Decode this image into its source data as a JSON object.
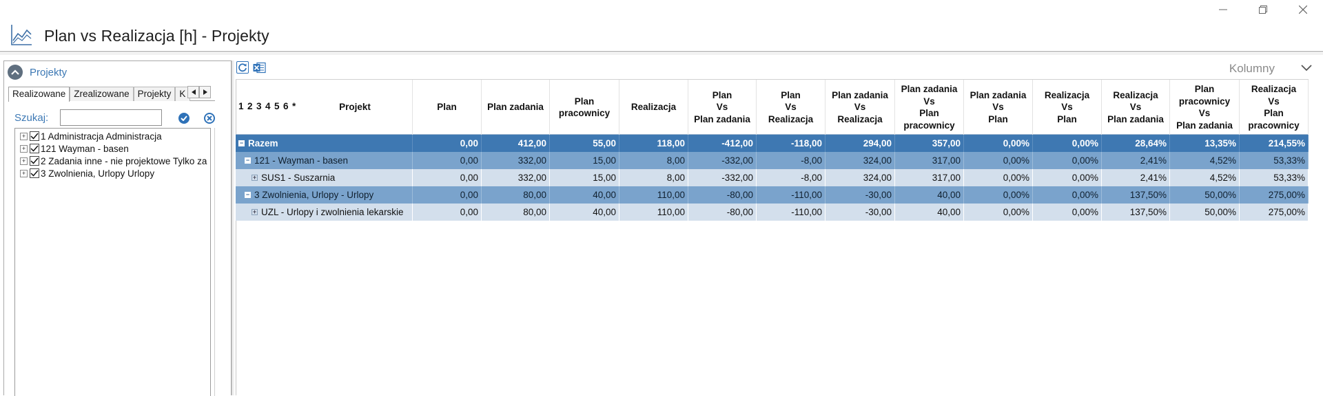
{
  "window": {
    "title": "Plan vs Realizacja [h] - Projekty",
    "controls": [
      "—",
      "❐",
      "✕"
    ]
  },
  "left_panel": {
    "title": "Projekty",
    "tabs": [
      "Realizowane",
      "Zrealizowane",
      "Projekty",
      "K"
    ],
    "search_label": "Szukaj:",
    "search_value": "",
    "tree": [
      "1 Administracja Administracja",
      "121 Wayman - basen",
      "2 Zadania inne - nie projektowe Tylko za",
      "3 Zwolnienia, Urlopy Urlopy"
    ]
  },
  "toolbar": {
    "columns_label": "Kolumny"
  },
  "grid": {
    "levels": [
      "1",
      "2",
      "3",
      "4",
      "5",
      "6",
      "*"
    ],
    "headers": [
      "Projekt",
      "Plan",
      "Plan zadania",
      "Plan\npracownicy",
      "Realizacja",
      "Plan\nVs\nPlan zadania",
      "Plan\nVs\nRealizacja",
      "Plan zadania\nVs\nRealizacja",
      "Plan zadania\nVs\nPlan\npracownicy",
      "Plan zadania\nVs\nPlan",
      "Realizacja\nVs\nPlan",
      "Realizacja\nVs\nPlan zadania",
      "Plan\npracownicy\nVs\nPlan zadania",
      "Realizacja\nVs\nPlan\npracownicy"
    ],
    "rows": [
      {
        "level": 0,
        "expander": "−",
        "name": "Razem",
        "values": [
          "0,00",
          "412,00",
          "55,00",
          "118,00",
          "-412,00",
          "-118,00",
          "294,00",
          "357,00",
          "0,00%",
          "0,00%",
          "28,64%",
          "13,35%",
          "214,55%"
        ]
      },
      {
        "level": 1,
        "expander": "−",
        "name": "121 - Wayman - basen",
        "values": [
          "0,00",
          "332,00",
          "15,00",
          "8,00",
          "-332,00",
          "-8,00",
          "324,00",
          "317,00",
          "0,00%",
          "0,00%",
          "2,41%",
          "4,52%",
          "53,33%"
        ]
      },
      {
        "level": 2,
        "expander": "+",
        "name": "SUS1 - Suszarnia",
        "values": [
          "0,00",
          "332,00",
          "15,00",
          "8,00",
          "-332,00",
          "-8,00",
          "324,00",
          "317,00",
          "0,00%",
          "0,00%",
          "2,41%",
          "4,52%",
          "53,33%"
        ]
      },
      {
        "level": 1,
        "expander": "−",
        "name": "3 Zwolnienia, Urlopy - Urlopy",
        "values": [
          "0,00",
          "80,00",
          "40,00",
          "110,00",
          "-80,00",
          "-110,00",
          "-30,00",
          "40,00",
          "0,00%",
          "0,00%",
          "137,50%",
          "50,00%",
          "275,00%"
        ]
      },
      {
        "level": 2,
        "expander": "+",
        "name": "UZL - Urlopy i zwolnienia lekarskie",
        "values": [
          "0,00",
          "80,00",
          "40,00",
          "110,00",
          "-80,00",
          "-110,00",
          "-30,00",
          "40,00",
          "0,00%",
          "0,00%",
          "137,50%",
          "50,00%",
          "275,00%"
        ]
      }
    ]
  }
}
